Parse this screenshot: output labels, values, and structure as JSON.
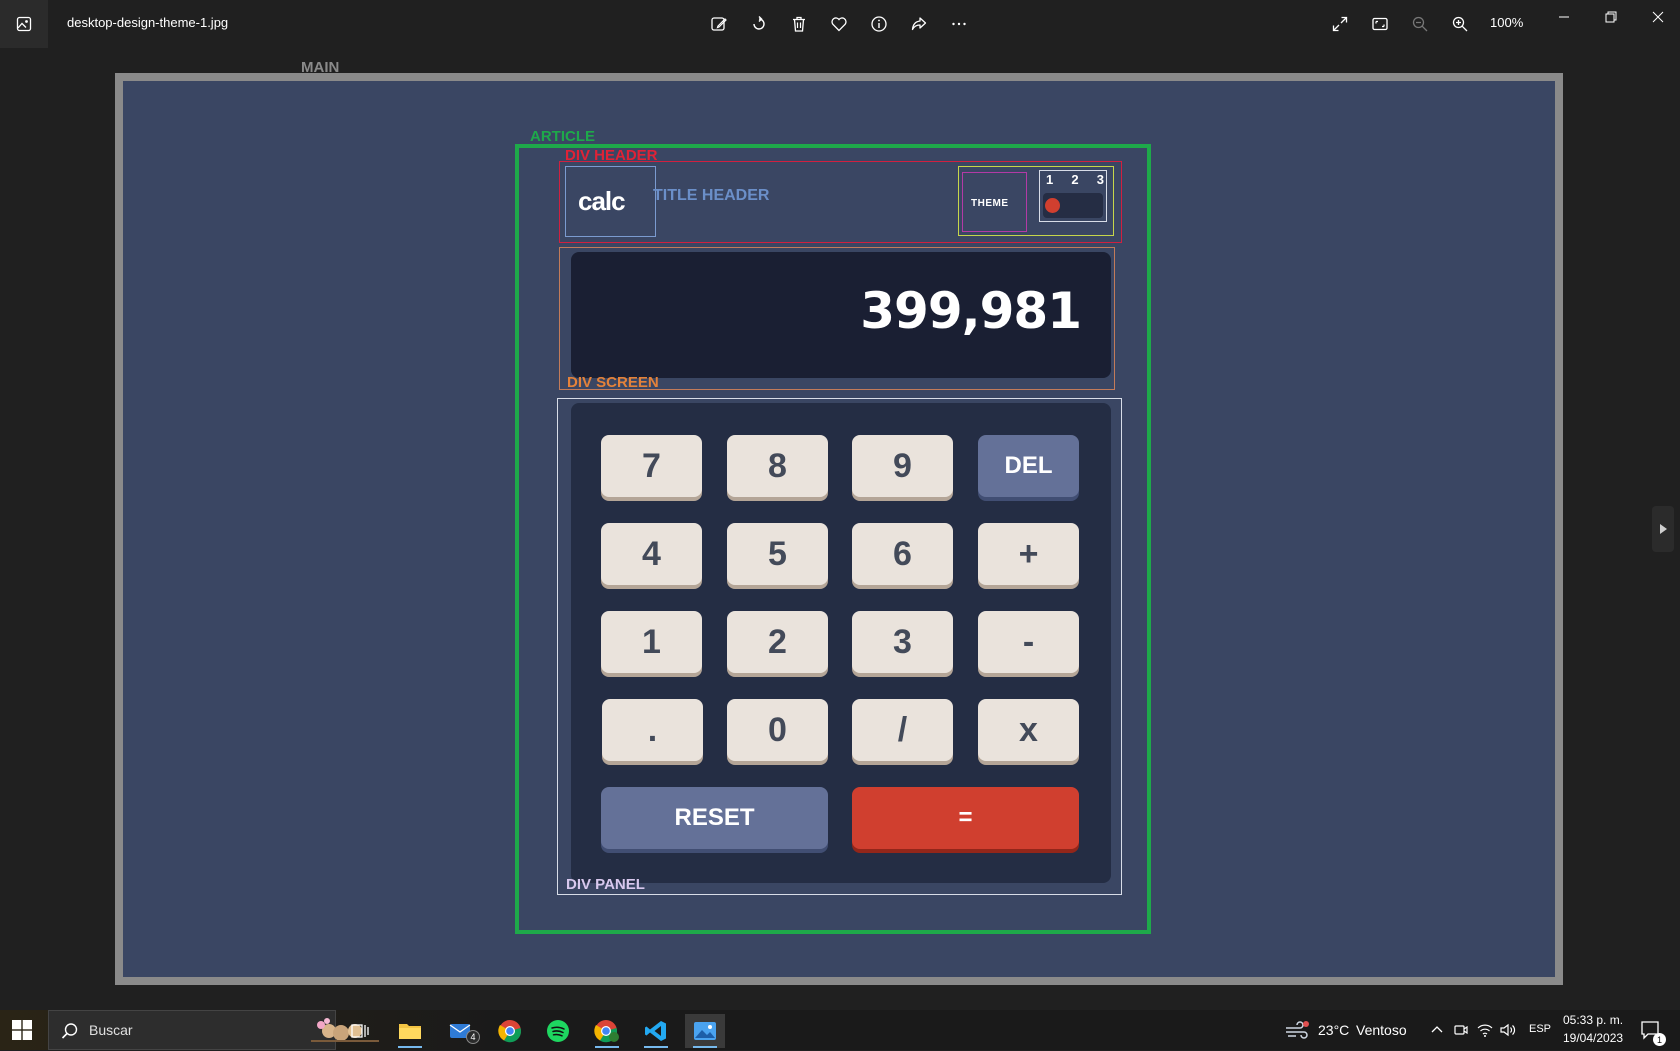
{
  "viewer": {
    "filename": "desktop-design-theme-1.jpg",
    "zoom": "100%"
  },
  "labels": {
    "main": "MAIN",
    "article": "ARTICLE",
    "div_header": "DIV HEADER",
    "title_header": "TITLE HEADER",
    "div_screen": "DIV SCREEN",
    "div_panel": "DIV PANEL"
  },
  "calc": {
    "logo": "calc",
    "theme_label": "THEME",
    "theme_options": [
      "1",
      "2",
      "3"
    ],
    "display": "399,981",
    "keys": [
      {
        "label": "7"
      },
      {
        "label": "8"
      },
      {
        "label": "9"
      },
      {
        "label": "DEL"
      },
      {
        "label": "4"
      },
      {
        "label": "5"
      },
      {
        "label": "6"
      },
      {
        "label": "+"
      },
      {
        "label": "1"
      },
      {
        "label": "2"
      },
      {
        "label": "3"
      },
      {
        "label": "-"
      },
      {
        "label": "."
      },
      {
        "label": "0"
      },
      {
        "label": "/"
      },
      {
        "label": "x"
      }
    ],
    "reset": "RESET",
    "equals": "="
  },
  "colors": {
    "canvas_bg": "#3a4663",
    "screen_bg": "#1a1f33",
    "panel_bg": "#242d44",
    "key_bg": "#eae3dc",
    "accent_key": "#647198",
    "equals_key": "#d03f2f",
    "article_outline": "#1ea94a"
  },
  "taskbar": {
    "search_placeholder": "Buscar",
    "mail_badge": "4",
    "weather": "23°C",
    "weather_text": "Ventoso",
    "language": "ESP",
    "time": "05:33 p. m.",
    "date": "19/04/2023",
    "notification_count": "1"
  }
}
